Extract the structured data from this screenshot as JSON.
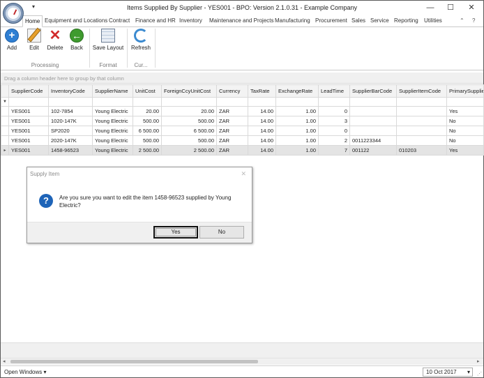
{
  "window": {
    "title": "Items Supplied By Supplier - YES001 - BPO: Version 2.1.0.31 - Example Company",
    "qat_arrow": "▾",
    "minimize": "—",
    "maximize": "☐",
    "close": "✕"
  },
  "ribbon": {
    "tabs": [
      "Home",
      "Equipment and Locations",
      "Contract",
      "Finance and HR",
      "Inventory",
      "Maintenance and Projects",
      "Manufacturing",
      "Procurement",
      "Sales",
      "Service",
      "Reporting",
      "Utilities"
    ],
    "collapse": "⌃",
    "help": "?",
    "buttons": {
      "add": "Add",
      "edit": "Edit",
      "delete": "Delete",
      "back": "Back",
      "save_layout": "Save Layout",
      "refresh": "Refresh"
    },
    "icons": {
      "add": "+",
      "delete": "✕",
      "back": "←"
    },
    "groups": {
      "processing": "Processing",
      "format": "Format",
      "cur": "Cur..."
    }
  },
  "grid": {
    "group_prompt": "Drag a column header here to group by that column",
    "columns": [
      "SupplierCode",
      "InventoryCode",
      "SupplierName",
      "UnitCost",
      "ForeignCcyUnitCost",
      "Currency",
      "TaxRate",
      "ExchangeRate",
      "LeadTime",
      "SupplierBarCode",
      "SupplierItemCode",
      "PrimarySupplier"
    ],
    "filter_icon": "▼",
    "row_indicator": "▸",
    "rows": [
      {
        "SupplierCode": "YES001",
        "InventoryCode": "102-7854",
        "SupplierName": "Young Electric",
        "UnitCost": "20.00",
        "ForeignCcyUnitCost": "20.00",
        "Currency": "ZAR",
        "TaxRate": "14.00",
        "ExchangeRate": "1.00",
        "LeadTime": "0",
        "SupplierBarCode": "",
        "SupplierItemCode": "",
        "PrimarySupplier": "Yes"
      },
      {
        "SupplierCode": "YES001",
        "InventoryCode": "1020-147K",
        "SupplierName": "Young Electric",
        "UnitCost": "500.00",
        "ForeignCcyUnitCost": "500.00",
        "Currency": "ZAR",
        "TaxRate": "14.00",
        "ExchangeRate": "1.00",
        "LeadTime": "3",
        "SupplierBarCode": "",
        "SupplierItemCode": "",
        "PrimarySupplier": "No"
      },
      {
        "SupplierCode": "YES001",
        "InventoryCode": "SP2020",
        "SupplierName": "Young Electric",
        "UnitCost": "6 500.00",
        "ForeignCcyUnitCost": "6 500.00",
        "Currency": "ZAR",
        "TaxRate": "14.00",
        "ExchangeRate": "1.00",
        "LeadTime": "0",
        "SupplierBarCode": "",
        "SupplierItemCode": "",
        "PrimarySupplier": "No"
      },
      {
        "SupplierCode": "YES001",
        "InventoryCode": "2020-147K",
        "SupplierName": "Young Electric",
        "UnitCost": "500.00",
        "ForeignCcyUnitCost": "500.00",
        "Currency": "ZAR",
        "TaxRate": "14.00",
        "ExchangeRate": "1.00",
        "LeadTime": "2",
        "SupplierBarCode": "0011223344",
        "SupplierItemCode": "",
        "PrimarySupplier": "No"
      },
      {
        "SupplierCode": "YES001",
        "InventoryCode": "1458-96523",
        "SupplierName": "Young Electric",
        "UnitCost": "2 500.00",
        "ForeignCcyUnitCost": "2 500.00",
        "Currency": "ZAR",
        "TaxRate": "14.00",
        "ExchangeRate": "1.00",
        "LeadTime": "7",
        "SupplierBarCode": "001122",
        "SupplierItemCode": "010203",
        "PrimarySupplier": "Yes"
      }
    ],
    "focused_row": 4
  },
  "dialog": {
    "title": "Supply Item",
    "close": "✕",
    "icon": "?",
    "message": "Are you sure you want to edit the item 1458-96523 supplied by Young Electric?",
    "yes": "Yes",
    "no": "No"
  },
  "scrollbar": {
    "left": "◂",
    "right": "▸"
  },
  "status": {
    "open_windows": "Open Windows ▾",
    "date": "10 Oct 2017",
    "date_arrow": "▾",
    "grip": "⋰"
  }
}
